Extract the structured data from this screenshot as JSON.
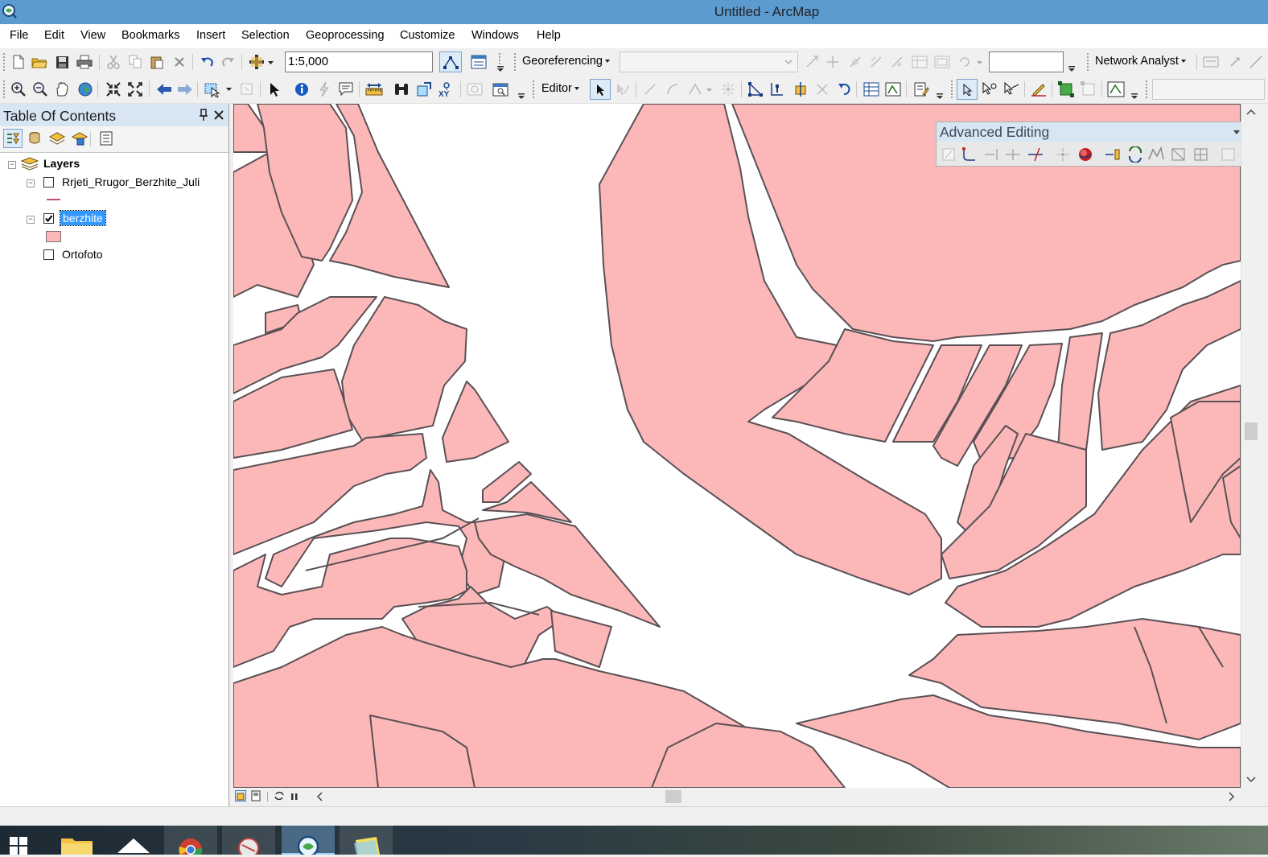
{
  "window": {
    "title": "Untitled - ArcMap"
  },
  "menu": [
    "File",
    "Edit",
    "View",
    "Bookmarks",
    "Insert",
    "Selection",
    "Geoprocessing",
    "Customize",
    "Windows",
    "Help"
  ],
  "toolbar1": {
    "scale_value": "1:5,000",
    "georeferencing_label": "Georeferencing",
    "georef_layer_value": "",
    "network_analyst_label": "Network Analyst"
  },
  "toolbar2": {
    "editor_label": "Editor"
  },
  "toc": {
    "title": "Table Of Contents",
    "root_label": "Layers",
    "layers": [
      {
        "name": "Rrjeti_Rrugor_Berzhite_Juli",
        "checked": false
      },
      {
        "name": "berzhite",
        "checked": true
      },
      {
        "name": "Ortofoto",
        "checked": false
      }
    ]
  },
  "advanced_editing": {
    "title": "Advanced Editing"
  },
  "colors": {
    "parcel_fill": "#fcb8b8",
    "parcel_stroke": "#5a5055",
    "titlebar": "#5b9bd0"
  }
}
